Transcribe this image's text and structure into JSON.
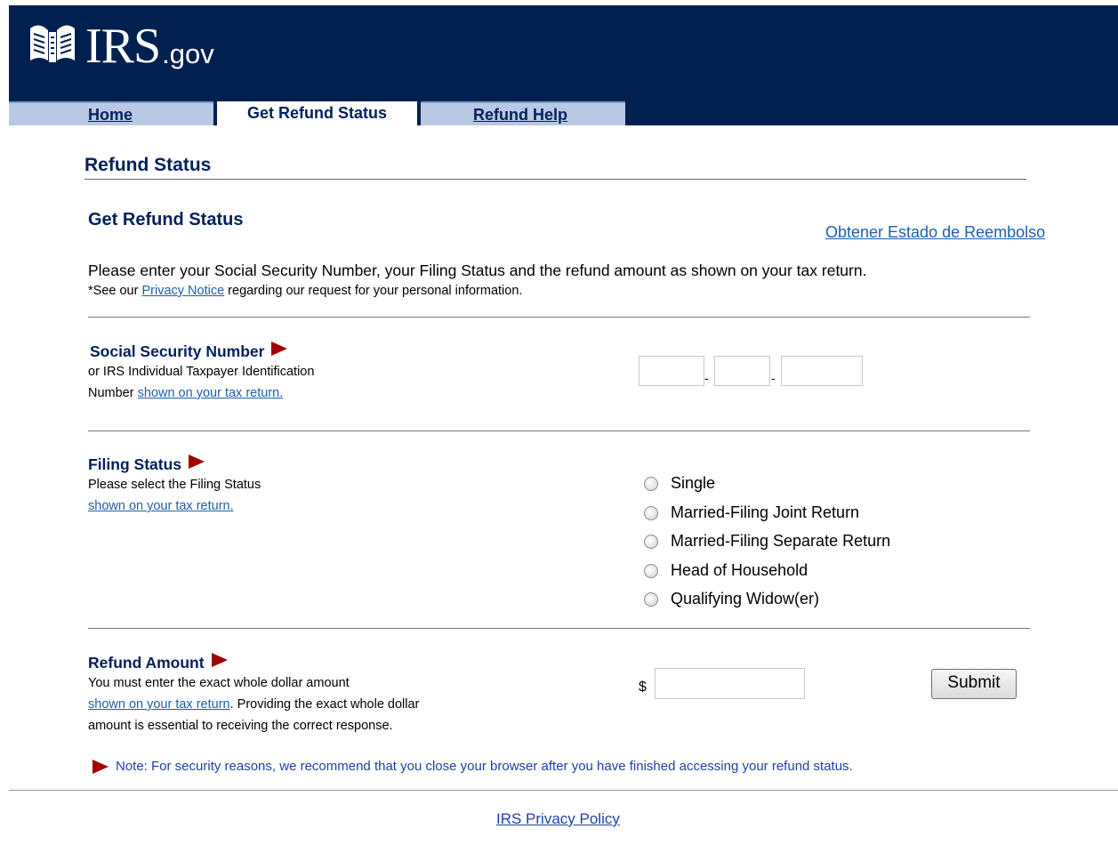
{
  "header": {
    "logo_main": "IRS",
    "logo_suffix": ".gov",
    "bg_color": "#00204f"
  },
  "tabs": [
    {
      "label": "Home",
      "active": false
    },
    {
      "label": "Get Refund Status",
      "active": true
    },
    {
      "label": "Refund Help",
      "active": false
    }
  ],
  "page_title": "Refund Status",
  "section_title": "Get Refund Status",
  "spanish_link": "Obtener Estado de Reembolso",
  "intro_text": "Please enter your Social Security Number, your Filing Status and the refund amount as shown on your tax return.",
  "privacy": {
    "prefix": "*See our",
    "link": "Privacy Notice",
    "suffix": "regarding our request for your personal information."
  },
  "ssn": {
    "label": "Social Security Number",
    "help_line1": "or IRS Individual Taxpayer Identification",
    "help_line2_prefix": "Number",
    "help_link": "shown on your tax return.",
    "separator": "-",
    "field1": "",
    "field2": "",
    "field3": ""
  },
  "filing_status": {
    "label": "Filing Status",
    "help_line1": "Please select the Filing Status",
    "help_link": "shown on your tax return.",
    "options": [
      "Single",
      "Married-Filing Joint Return",
      "Married-Filing Separate Return",
      "Head of Household",
      "Qualifying Widow(er)"
    ]
  },
  "refund_amount": {
    "label": "Refund Amount",
    "help_line1": "You must enter the exact whole dollar amount",
    "help_link": "shown on your tax return",
    "help_line2_suffix": ". Providing the exact whole dollar",
    "help_line3": "amount is essential to receiving the correct response.",
    "currency_symbol": "$",
    "value": ""
  },
  "submit_label": "Submit",
  "security_note": "Note: For security reasons, we recommend that you close your browser after you have finished accessing your refund status.",
  "footer_link": "IRS Privacy Policy",
  "colors": {
    "accent_arrow": "#a00000",
    "heading": "#00205b",
    "link": "#1f5fa8"
  }
}
